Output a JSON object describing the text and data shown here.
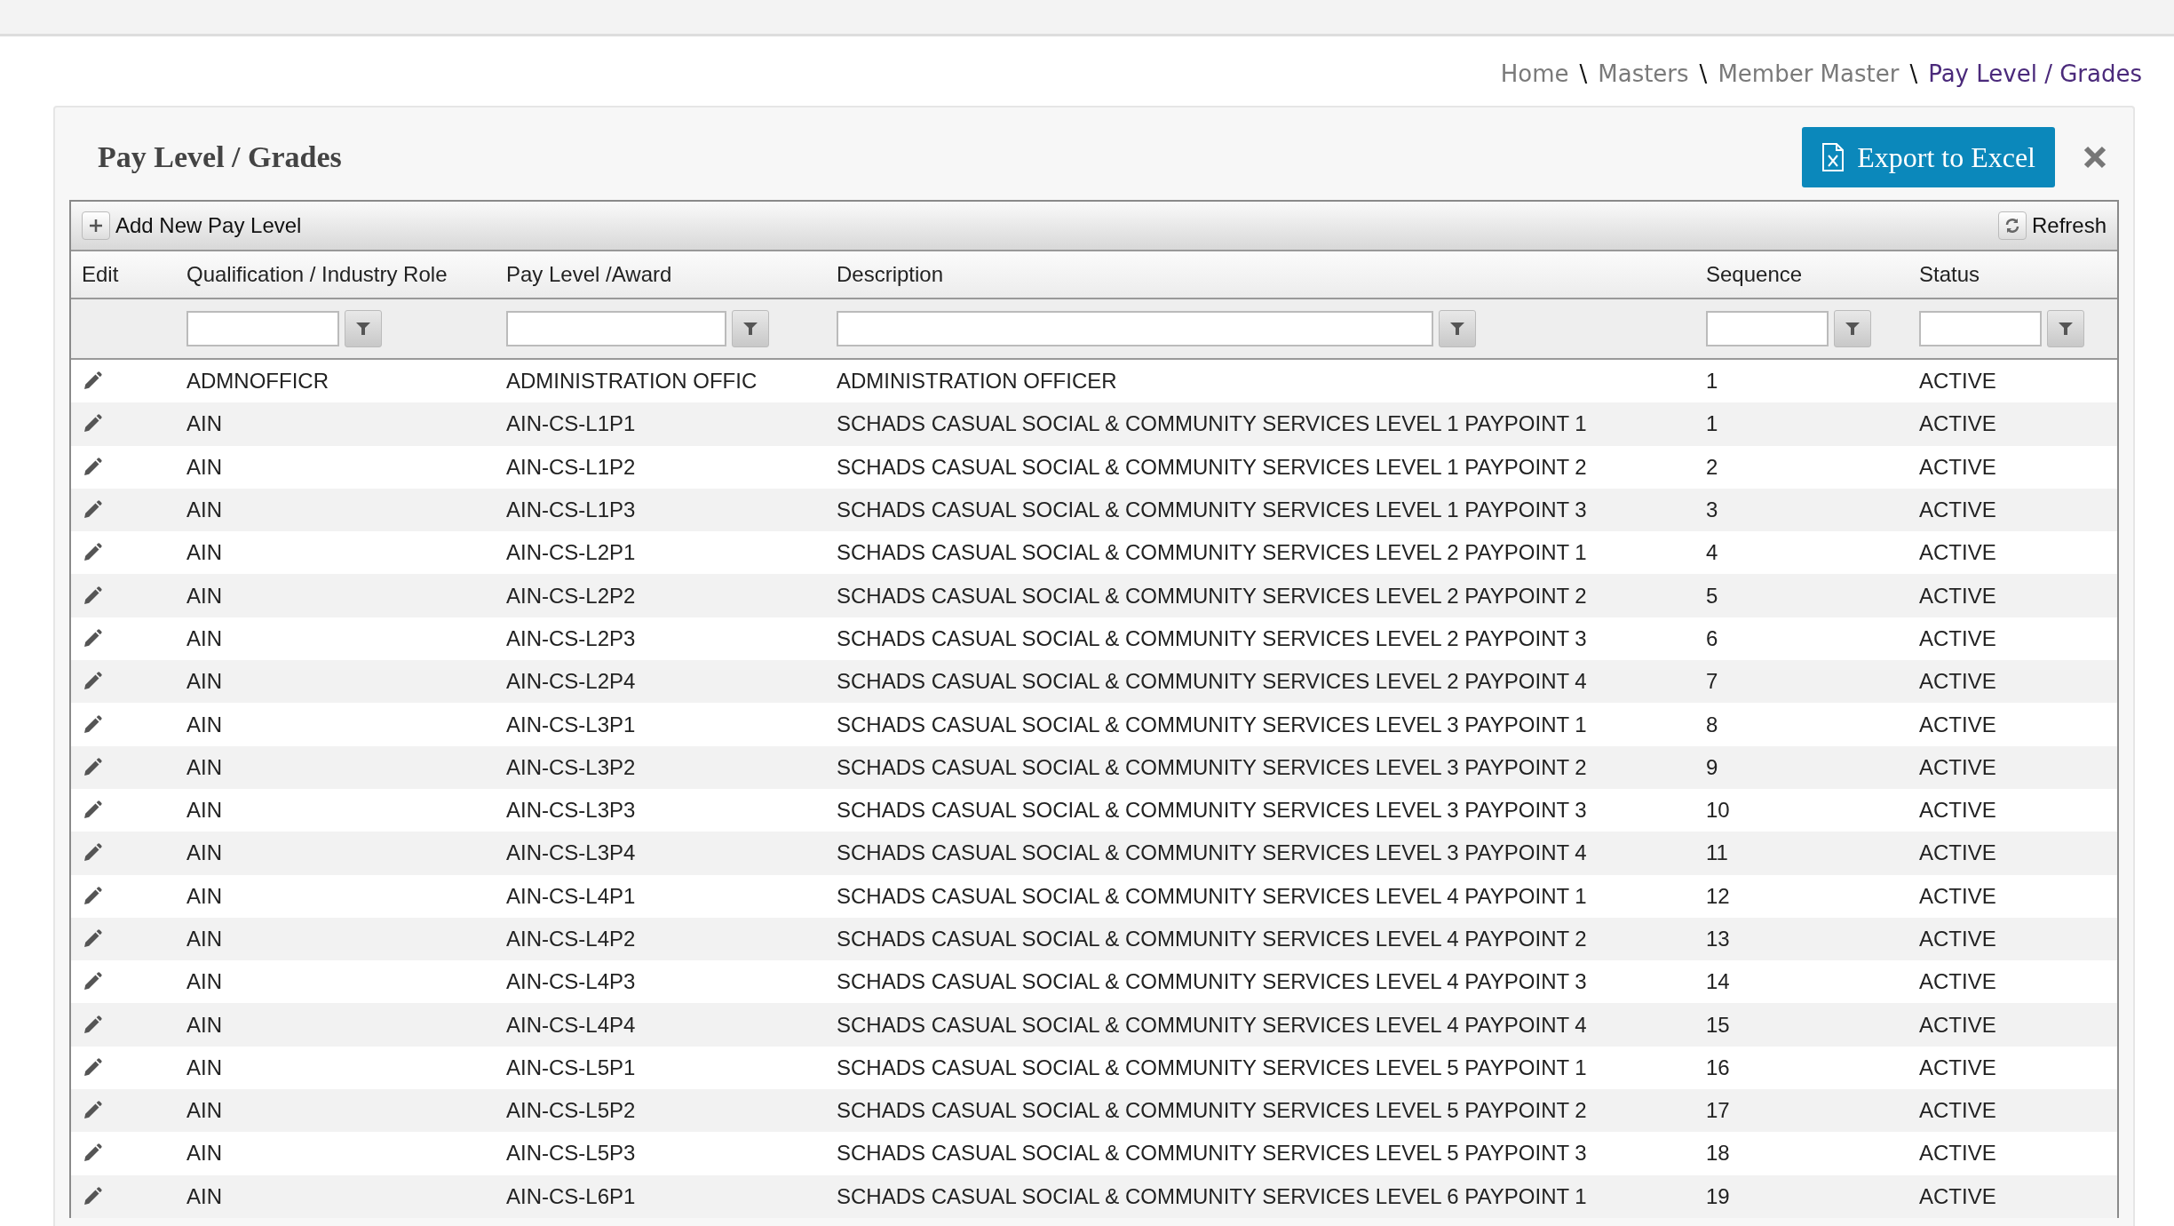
{
  "breadcrumb_separator": "\\",
  "breadcrumb": [
    {
      "label": "Home",
      "current": false
    },
    {
      "label": "Masters",
      "current": false
    },
    {
      "label": "Member Master",
      "current": false
    },
    {
      "label": "Pay Level / Grades",
      "current": true
    }
  ],
  "panel": {
    "title": "Pay Level / Grades",
    "export_button": "Export to Excel"
  },
  "toolbar": {
    "add_button": "Add New Pay Level",
    "refresh_button": "Refresh"
  },
  "table": {
    "columns": [
      {
        "label": "Edit",
        "filterable": false
      },
      {
        "label": "Qualification / Industry Role",
        "filterable": true
      },
      {
        "label": "Pay Level /Award",
        "filterable": true
      },
      {
        "label": "Description",
        "filterable": true
      },
      {
        "label": "Sequence",
        "filterable": true
      },
      {
        "label": "Status",
        "filterable": true
      }
    ],
    "rows": [
      {
        "qualification": "ADMNOFFICR",
        "pay_level": "ADMINISTRATION OFFIC",
        "description": "ADMINISTRATION OFFICER",
        "sequence": "1",
        "status": "ACTIVE"
      },
      {
        "qualification": "AIN",
        "pay_level": "AIN-CS-L1P1",
        "description": "SCHADS CASUAL SOCIAL & COMMUNITY SERVICES LEVEL 1 PAYPOINT 1",
        "sequence": "1",
        "status": "ACTIVE"
      },
      {
        "qualification": "AIN",
        "pay_level": "AIN-CS-L1P2",
        "description": "SCHADS CASUAL SOCIAL & COMMUNITY SERVICES LEVEL 1 PAYPOINT 2",
        "sequence": "2",
        "status": "ACTIVE"
      },
      {
        "qualification": "AIN",
        "pay_level": "AIN-CS-L1P3",
        "description": "SCHADS CASUAL SOCIAL & COMMUNITY SERVICES LEVEL 1 PAYPOINT 3",
        "sequence": "3",
        "status": "ACTIVE"
      },
      {
        "qualification": "AIN",
        "pay_level": "AIN-CS-L2P1",
        "description": "SCHADS CASUAL SOCIAL & COMMUNITY SERVICES LEVEL 2 PAYPOINT 1",
        "sequence": "4",
        "status": "ACTIVE"
      },
      {
        "qualification": "AIN",
        "pay_level": "AIN-CS-L2P2",
        "description": "SCHADS CASUAL SOCIAL & COMMUNITY SERVICES LEVEL 2 PAYPOINT 2",
        "sequence": "5",
        "status": "ACTIVE"
      },
      {
        "qualification": "AIN",
        "pay_level": "AIN-CS-L2P3",
        "description": "SCHADS CASUAL SOCIAL & COMMUNITY SERVICES LEVEL 2 PAYPOINT 3",
        "sequence": "6",
        "status": "ACTIVE"
      },
      {
        "qualification": "AIN",
        "pay_level": "AIN-CS-L2P4",
        "description": "SCHADS CASUAL SOCIAL & COMMUNITY SERVICES LEVEL 2 PAYPOINT 4",
        "sequence": "7",
        "status": "ACTIVE"
      },
      {
        "qualification": "AIN",
        "pay_level": "AIN-CS-L3P1",
        "description": "SCHADS CASUAL SOCIAL & COMMUNITY SERVICES LEVEL 3 PAYPOINT 1",
        "sequence": "8",
        "status": "ACTIVE"
      },
      {
        "qualification": "AIN",
        "pay_level": "AIN-CS-L3P2",
        "description": "SCHADS CASUAL SOCIAL & COMMUNITY SERVICES LEVEL 3 PAYPOINT 2",
        "sequence": "9",
        "status": "ACTIVE"
      },
      {
        "qualification": "AIN",
        "pay_level": "AIN-CS-L3P3",
        "description": "SCHADS CASUAL SOCIAL & COMMUNITY SERVICES LEVEL 3 PAYPOINT 3",
        "sequence": "10",
        "status": "ACTIVE"
      },
      {
        "qualification": "AIN",
        "pay_level": "AIN-CS-L3P4",
        "description": "SCHADS CASUAL SOCIAL & COMMUNITY SERVICES LEVEL 3 PAYPOINT 4",
        "sequence": "11",
        "status": "ACTIVE"
      },
      {
        "qualification": "AIN",
        "pay_level": "AIN-CS-L4P1",
        "description": "SCHADS CASUAL SOCIAL & COMMUNITY SERVICES LEVEL 4 PAYPOINT 1",
        "sequence": "12",
        "status": "ACTIVE"
      },
      {
        "qualification": "AIN",
        "pay_level": "AIN-CS-L4P2",
        "description": "SCHADS CASUAL SOCIAL & COMMUNITY SERVICES LEVEL 4 PAYPOINT 2",
        "sequence": "13",
        "status": "ACTIVE"
      },
      {
        "qualification": "AIN",
        "pay_level": "AIN-CS-L4P3",
        "description": "SCHADS CASUAL SOCIAL & COMMUNITY SERVICES LEVEL 4 PAYPOINT 3",
        "sequence": "14",
        "status": "ACTIVE"
      },
      {
        "qualification": "AIN",
        "pay_level": "AIN-CS-L4P4",
        "description": "SCHADS CASUAL SOCIAL & COMMUNITY SERVICES LEVEL 4 PAYPOINT 4",
        "sequence": "15",
        "status": "ACTIVE"
      },
      {
        "qualification": "AIN",
        "pay_level": "AIN-CS-L5P1",
        "description": "SCHADS CASUAL SOCIAL & COMMUNITY SERVICES LEVEL 5 PAYPOINT 1",
        "sequence": "16",
        "status": "ACTIVE"
      },
      {
        "qualification": "AIN",
        "pay_level": "AIN-CS-L5P2",
        "description": "SCHADS CASUAL SOCIAL & COMMUNITY SERVICES LEVEL 5 PAYPOINT 2",
        "sequence": "17",
        "status": "ACTIVE"
      },
      {
        "qualification": "AIN",
        "pay_level": "AIN-CS-L5P3",
        "description": "SCHADS CASUAL SOCIAL & COMMUNITY SERVICES LEVEL 5 PAYPOINT 3",
        "sequence": "18",
        "status": "ACTIVE"
      },
      {
        "qualification": "AIN",
        "pay_level": "AIN-CS-L6P1",
        "description": "SCHADS CASUAL SOCIAL & COMMUNITY SERVICES LEVEL 6 PAYPOINT 1",
        "sequence": "19",
        "status": "ACTIVE"
      }
    ]
  }
}
